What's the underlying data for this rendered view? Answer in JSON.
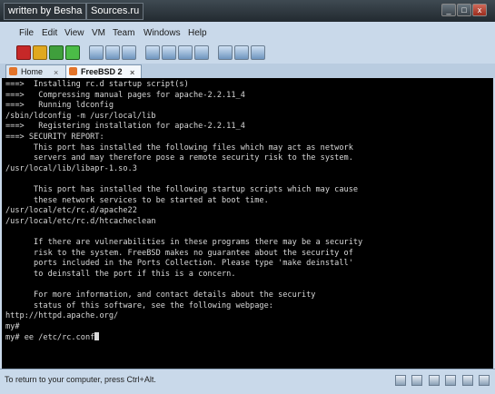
{
  "watermarks": {
    "author": "written by Besha",
    "source": "Sources.ru"
  },
  "menu": [
    "File",
    "Edit",
    "View",
    "VM",
    "Team",
    "Windows",
    "Help"
  ],
  "tabs": [
    {
      "label": "Home",
      "active": false
    },
    {
      "label": "FreeBSD 2",
      "active": true
    }
  ],
  "terminal_lines": [
    "===>  Installing rc.d startup script(s)",
    "===>   Compressing manual pages for apache-2.2.11_4",
    "===>   Running ldconfig",
    "/sbin/ldconfig -m /usr/local/lib",
    "===>   Registering installation for apache-2.2.11_4",
    "===> SECURITY REPORT:",
    "      This port has installed the following files which may act as network",
    "      servers and may therefore pose a remote security risk to the system.",
    "/usr/local/lib/libapr-1.so.3",
    "",
    "      This port has installed the following startup scripts which may cause",
    "      these network services to be started at boot time.",
    "/usr/local/etc/rc.d/apache22",
    "/usr/local/etc/rc.d/htcacheclean",
    "",
    "      If there are vulnerabilities in these programs there may be a security",
    "      risk to the system. FreeBSD makes no guarantee about the security of",
    "      ports included in the Ports Collection. Please type 'make deinstall'",
    "      to deinstall the port if this is a concern.",
    "",
    "      For more information, and contact details about the security",
    "      status of this software, see the following webpage:",
    "http://httpd.apache.org/",
    "my#",
    "my# ee /etc/rc.conf"
  ],
  "status": {
    "text": "To return to your computer, press Ctrl+Alt."
  },
  "colors": {
    "terminal_bg": "#000000",
    "terminal_fg": "#d8d8d8",
    "chrome": "#c9d9ea"
  }
}
